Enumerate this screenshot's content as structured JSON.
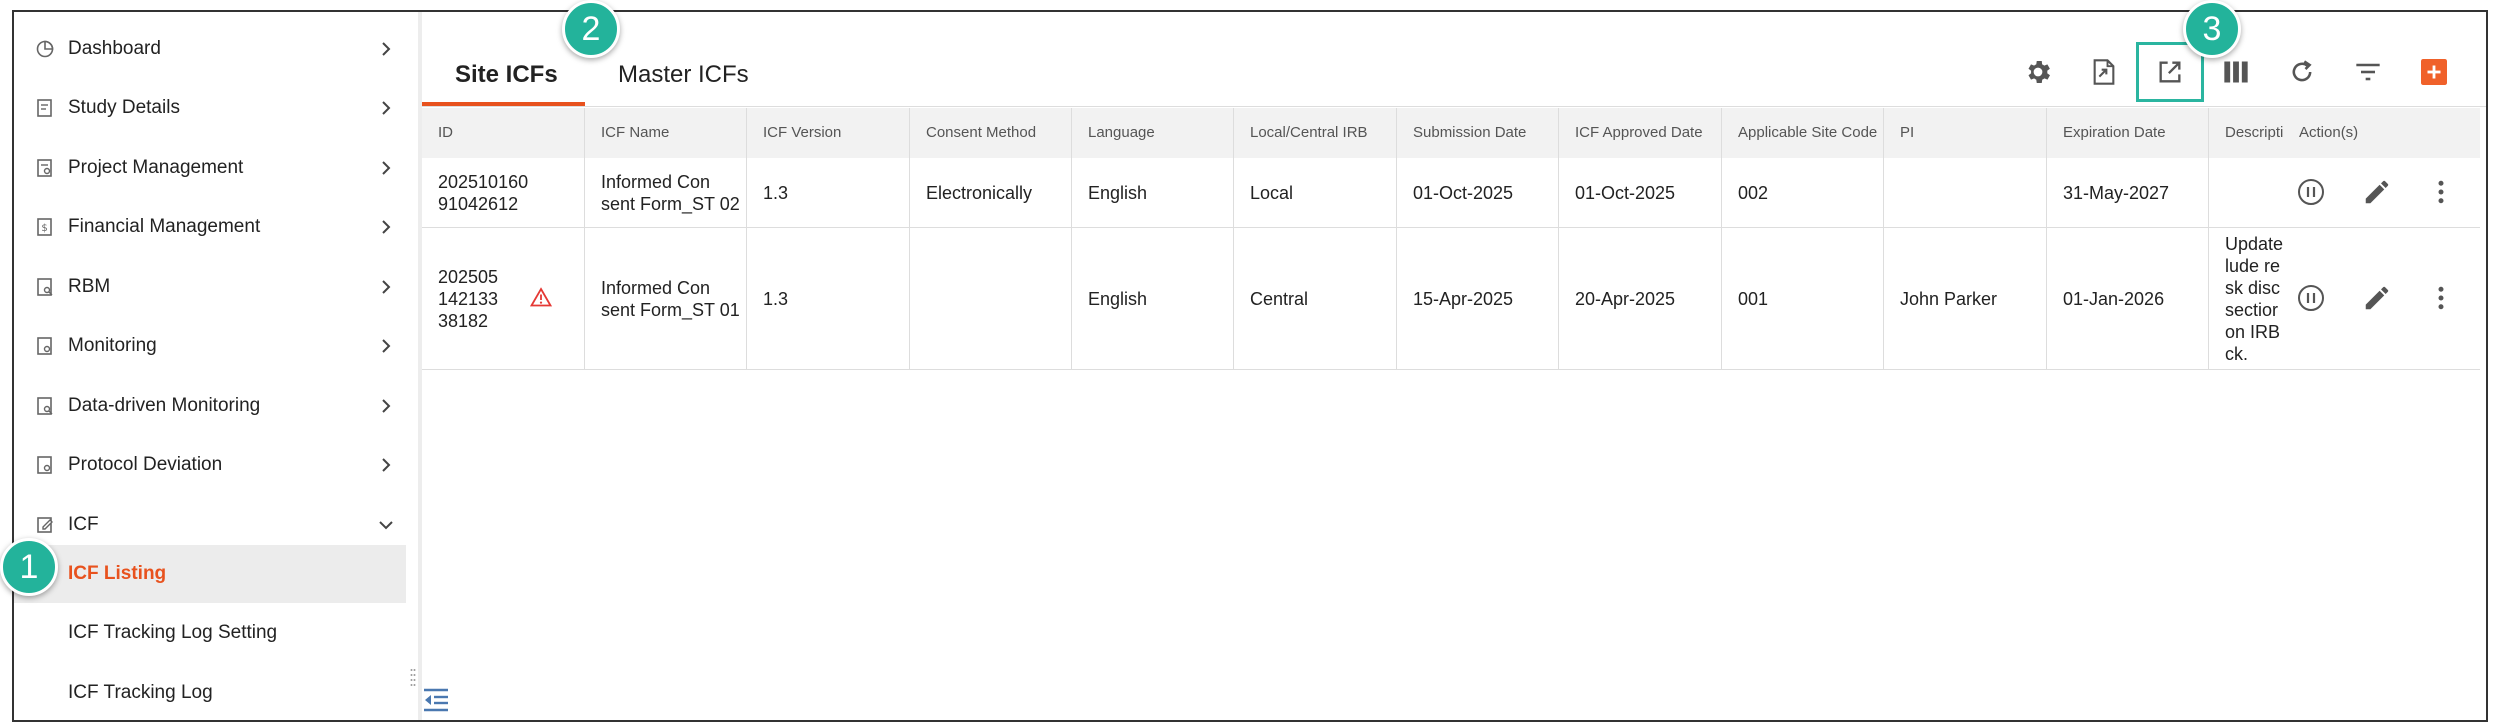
{
  "sidebar": {
    "items": [
      {
        "label": "Dashboard",
        "icon": "dashboard-icon"
      },
      {
        "label": "Study Details",
        "icon": "study-details-icon"
      },
      {
        "label": "Project Management",
        "icon": "project-management-icon"
      },
      {
        "label": "Financial Management",
        "icon": "financial-management-icon"
      },
      {
        "label": "RBM",
        "icon": "rbm-icon"
      },
      {
        "label": "Monitoring",
        "icon": "monitoring-icon"
      },
      {
        "label": "Data-driven Monitoring",
        "icon": "data-driven-monitoring-icon"
      },
      {
        "label": "Protocol Deviation",
        "icon": "protocol-deviation-icon"
      },
      {
        "label": "ICF",
        "icon": "icf-icon",
        "expanded": true
      }
    ],
    "subitems": [
      {
        "label": "ICF Listing",
        "active": true
      },
      {
        "label": "ICF Tracking Log Setting"
      },
      {
        "label": "ICF Tracking Log"
      }
    ]
  },
  "tabs": [
    {
      "label": "Site ICFs",
      "active": true
    },
    {
      "label": "Master ICFs"
    }
  ],
  "toolbar": {
    "buttons": [
      "settings-icon",
      "export-file-icon",
      "open-external-icon",
      "columns-icon",
      "refresh-icon",
      "filter-icon",
      "add-icon"
    ],
    "accent": "#e8521e"
  },
  "badges": [
    "1",
    "2",
    "3"
  ],
  "table": {
    "headers": [
      "ID",
      "ICF Name",
      "ICF Version",
      "Consent Method",
      "Language",
      "Local/Central IRB",
      "Submission Date",
      "ICF Approved Date",
      "Applicable Site Code",
      "PI",
      "Expiration Date",
      "Descripti",
      "Action(s)"
    ],
    "rows": [
      {
        "id": "202510160 91042612",
        "warning": false,
        "icf_name": "Informed Con sent Form_ST 02",
        "version": "1.3",
        "consent_method": "Electronically",
        "language": "English",
        "irb": "Local",
        "submission_date": "01-Oct-2025",
        "approved_date": "01-Oct-2025",
        "site_code": "002",
        "pi": "",
        "expiration_date": "31-May-2027",
        "description": ""
      },
      {
        "id": "202505 142133 38182",
        "warning": true,
        "icf_name": "Informed Con sent Form_ST 01",
        "version": "1.3",
        "consent_method": "",
        "language": "English",
        "irb": "Central",
        "submission_date": "15-Apr-2025",
        "approved_date": "20-Apr-2025",
        "site_code": "001",
        "pi": "John Parker",
        "expiration_date": "01-Jan-2026",
        "description": "Update lude re sk disc sectior on IRB ck."
      }
    ]
  },
  "colors": {
    "accent": "#e8521e",
    "badge": "#23b39b",
    "highlight": "#2ab5a0",
    "warning": "#e53935"
  }
}
